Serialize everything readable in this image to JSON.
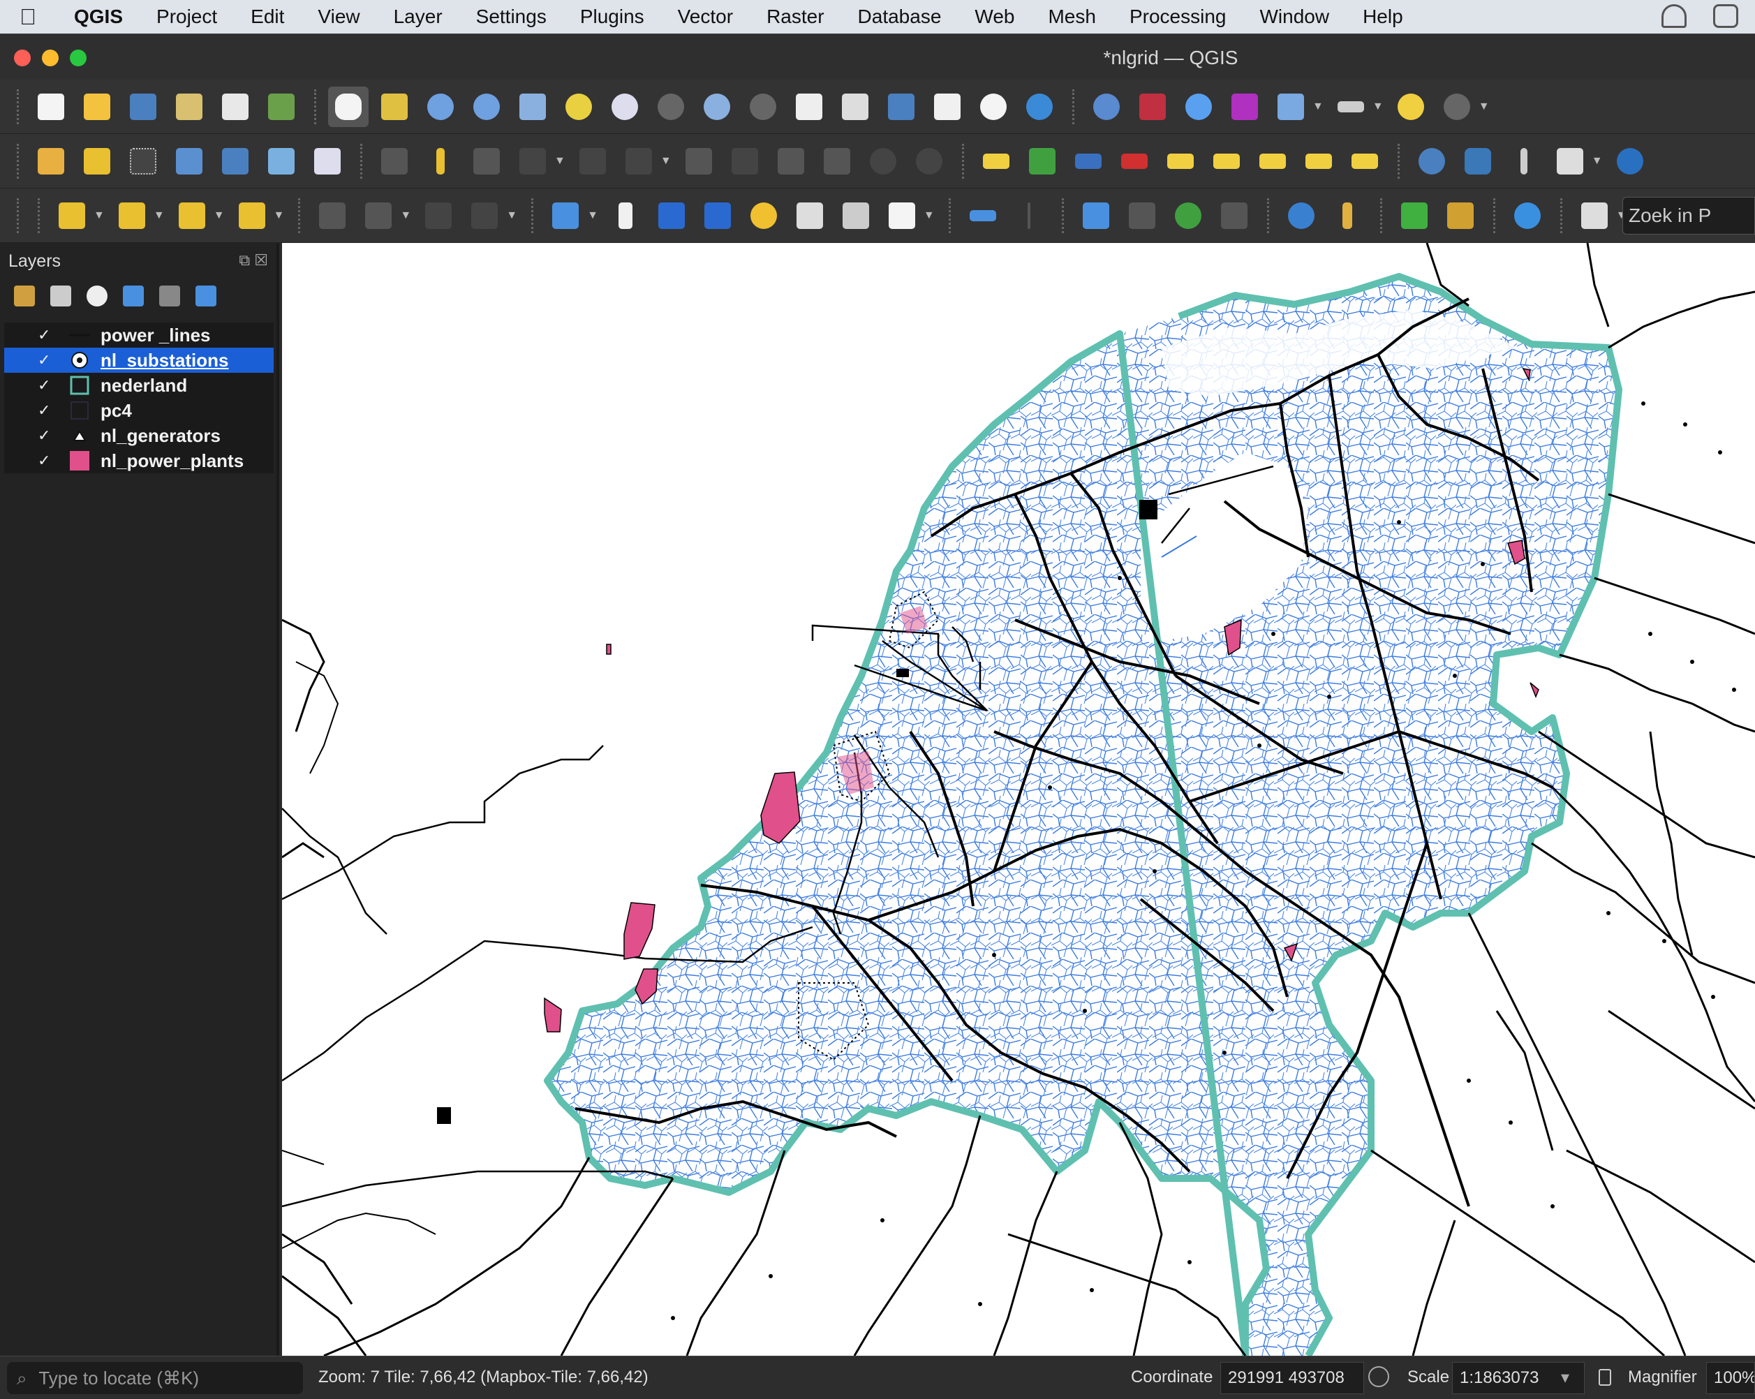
{
  "menubar": {
    "app": "QGIS",
    "items": [
      "Project",
      "Edit",
      "View",
      "Layer",
      "Settings",
      "Plugins",
      "Vector",
      "Raster",
      "Database",
      "Web",
      "Mesh",
      "Processing",
      "Window",
      "Help"
    ]
  },
  "window": {
    "title": "*nlgrid — QGIS"
  },
  "toolbar3": {
    "search_placeholder": "Zoek in P"
  },
  "layers_panel": {
    "title": "Layers",
    "layers": [
      {
        "name": "power _lines",
        "checked": true,
        "symbol": "line-icon",
        "selected": false
      },
      {
        "name": "nl_substations",
        "checked": true,
        "symbol": "point-icon",
        "selected": true
      },
      {
        "name": "nederland",
        "checked": true,
        "symbol": "polygon-outline-icon",
        "selected": false
      },
      {
        "name": "pc4",
        "checked": true,
        "symbol": "polygon-empty-icon",
        "selected": false
      },
      {
        "name": "nl_generators",
        "checked": true,
        "symbol": "triangle-icon",
        "selected": false
      },
      {
        "name": "nl_power_plants",
        "checked": true,
        "symbol": "polygon-fill-icon",
        "selected": false
      }
    ],
    "check_glyph": "✓"
  },
  "statusbar": {
    "locator_placeholder": "Type to locate (⌘K)",
    "zoom_info": "Zoom: 7   Tile: 7,66,42   (Mapbox-Tile: 7,66,42)",
    "coordinate_label": "Coordinate",
    "coordinate_value": "291991  493708",
    "scale_label": "Scale",
    "scale_value": "1:1863073",
    "magnifier_label": "Magnifier",
    "magnifier_value": "100%"
  },
  "colors": {
    "nederland_outline": "#5fc0b0",
    "pc4_lines": "#3a7ae0",
    "power_plants": "#e0508a",
    "selection": "#1a5fd6"
  }
}
